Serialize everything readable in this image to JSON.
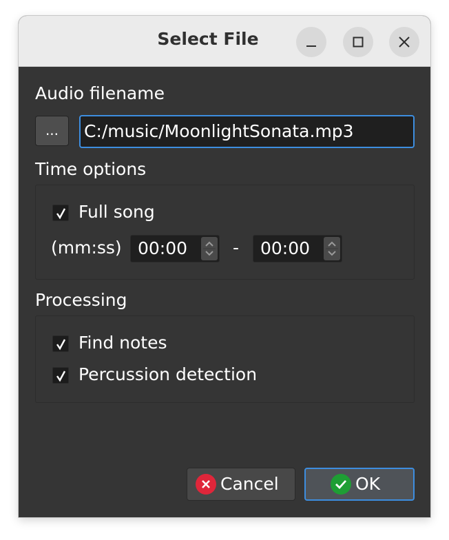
{
  "window": {
    "title": "Select File"
  },
  "file": {
    "section_label": "Audio filename",
    "browse_label": "...",
    "path": "C:/music/MoonlightSonata.mp3"
  },
  "time_options": {
    "section_label": "Time options",
    "full_song_label": "Full song",
    "full_song_checked": true,
    "format_label": "(mm:ss)",
    "start": "00:00",
    "separator": "-",
    "end": "00:00"
  },
  "processing": {
    "section_label": "Processing",
    "find_notes_label": "Find notes",
    "find_notes_checked": true,
    "percussion_label": "Percussion detection",
    "percussion_checked": true
  },
  "buttons": {
    "cancel_label": "Cancel",
    "ok_label": "OK"
  },
  "colors": {
    "accent": "#3d8ee0",
    "cancel_icon": "#e0263a",
    "ok_icon": "#1e9e34"
  },
  "icons": {
    "minimize": "minimize-icon",
    "maximize": "maximize-icon",
    "close": "close-icon",
    "checkmark": "checkmark-icon",
    "spin_up": "chevron-up-icon",
    "spin_down": "chevron-down-icon",
    "cancel": "cancel-icon",
    "ok": "ok-icon"
  }
}
